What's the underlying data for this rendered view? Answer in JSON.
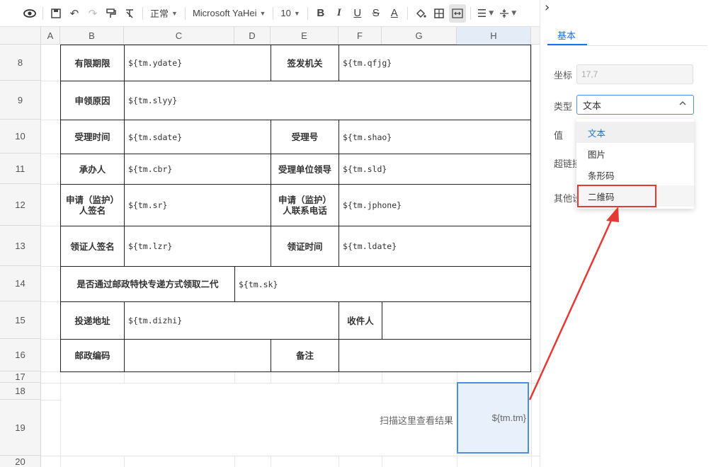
{
  "toolbar": {
    "format_value": "正常",
    "font_value": "Microsoft YaHei",
    "size_value": "10"
  },
  "columns": [
    "A",
    "B",
    "C",
    "D",
    "E",
    "F",
    "G",
    "H"
  ],
  "rows": [
    "8",
    "9",
    "10",
    "11",
    "12",
    "13",
    "14",
    "15",
    "16",
    "17",
    "18",
    "19",
    "20"
  ],
  "table": {
    "r8": {
      "l1": "有限期限",
      "v1": "${tm.ydate}",
      "l2": "签发机关",
      "v2": "${tm.qfjg}"
    },
    "r9": {
      "l1": "申领原因",
      "v1": "${tm.slyy}"
    },
    "r10": {
      "l1": "受理时间",
      "v1": "${tm.sdate}",
      "l2": "受理号",
      "v2": "${tm.shao}"
    },
    "r11": {
      "l1": "承办人",
      "v1": "${tm.cbr}",
      "l2": "受理单位领导",
      "v2": "${tm.sld}"
    },
    "r12": {
      "l1a": "申请（监护）",
      "l1b": "人签名",
      "v1": "${tm.sr}",
      "l2a": "申请（监护）",
      "l2b": "人联系电话",
      "v2": "${tm.jphone}"
    },
    "r13": {
      "l1": "领证人签名",
      "v1": "${tm.lzr}",
      "l2": "领证时间",
      "v2": "${tm.ldate}"
    },
    "r14": {
      "l1": "是否通过邮政特快专递方式领取二代",
      "v1": "${tm.sk}"
    },
    "r15": {
      "l1": "投递地址",
      "v1": "${tm.dizhi}",
      "l2": "收件人"
    },
    "r16": {
      "l1": "邮政编码",
      "l2": "备注"
    }
  },
  "scan_text": "扫描这里查看结果",
  "selected_cell_value": "${tm.tm}",
  "panel": {
    "tab_basic": "基本",
    "coord_label": "坐标",
    "coord_value": "17,7",
    "type_label": "类型",
    "type_value": "文本",
    "value_label": "值",
    "link_label": "超链接",
    "other_label": "其他设",
    "options": [
      "文本",
      "图片",
      "条形码",
      "二维码"
    ]
  },
  "colors": {
    "accent": "#1a73e8",
    "highlight": "#e53935",
    "selected_cell_bg": "#e8f0fc"
  }
}
